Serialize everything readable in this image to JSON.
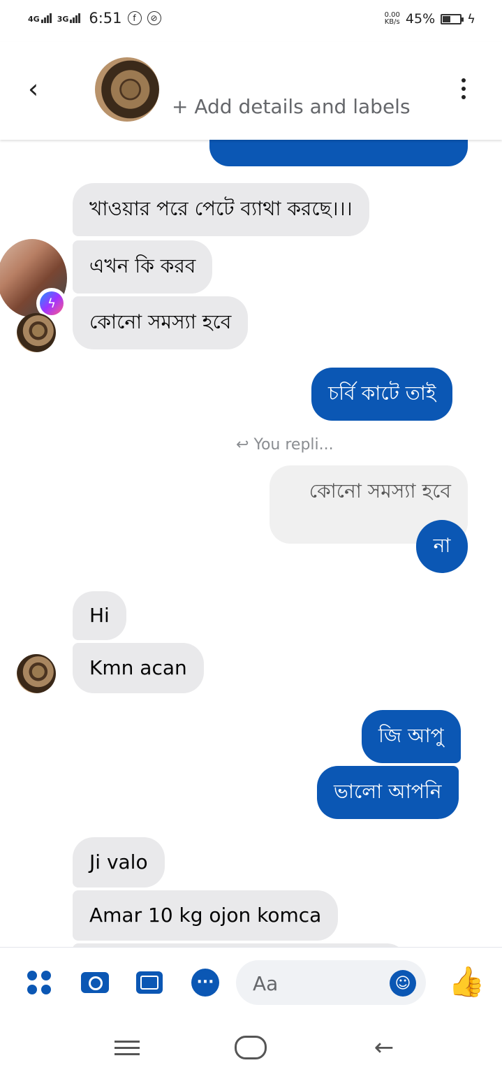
{
  "status_bar": {
    "net1": "4G",
    "net2": "3G",
    "time": "6:51",
    "icon1": "f",
    "icon2": "⊘",
    "speed_value": "0.00",
    "speed_unit": "KB/s",
    "battery": "45%",
    "battery_level": 0.45
  },
  "header": {
    "add_details": "+ Add details and labels"
  },
  "messages": [
    {
      "side": "in",
      "text": "খাওয়ার পরে পেটে  ব্যাথা করছে।।।"
    },
    {
      "side": "in",
      "text": "এখন কি করব"
    },
    {
      "side": "in",
      "text": "কোনো সমস্যা  হবে"
    },
    {
      "side": "out",
      "text": "চর্বি কাটে তাই"
    },
    {
      "side": "out_reply_label",
      "text": "You repli..."
    },
    {
      "side": "quoted",
      "text": "কোনো সমস্যা  হবে"
    },
    {
      "side": "out",
      "text": "না"
    },
    {
      "side": "in",
      "text": "Hi"
    },
    {
      "side": "in",
      "text": "Kmn acan"
    },
    {
      "side": "out",
      "text": "জি আপু"
    },
    {
      "side": "out",
      "text": "ভালো আপনি"
    },
    {
      "side": "in",
      "text": "Ji valo"
    },
    {
      "side": "in",
      "text": "Amar 10 kg ojon komca"
    }
  ],
  "composer": {
    "placeholder": "Aa"
  },
  "colors": {
    "outgoing_bubble": "#0b57b4",
    "incoming_bubble": "#e9e9eb",
    "accent": "#0b57b4"
  },
  "icons": {
    "apps": "apps-grid-icon",
    "camera": "camera-icon",
    "gallery": "gallery-icon",
    "chat": "chat-bubble-icon",
    "emoji": "emoji-icon",
    "like": "thumbs-up-icon",
    "back": "back-chevron-icon",
    "menu": "more-vertical-icon"
  }
}
